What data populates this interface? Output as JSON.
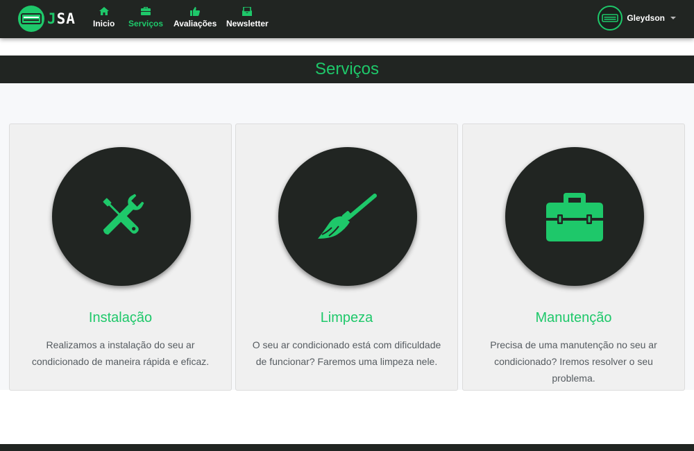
{
  "brand": {
    "letter_j": "J",
    "letters_sa": "SA",
    "logo_icon": "air-conditioner-icon"
  },
  "nav": [
    {
      "label": "Inicio",
      "icon": "home-icon",
      "active": false
    },
    {
      "label": "Serviços",
      "icon": "toolbox-icon",
      "active": true
    },
    {
      "label": "Avaliações",
      "icon": "thumbs-up-icon",
      "active": false
    },
    {
      "label": "Newsletter",
      "icon": "newsletter-icon",
      "active": false
    }
  ],
  "user": {
    "name": "Gleydson",
    "avatar_icon": "air-conditioner-icon"
  },
  "section": {
    "title": "Serviços"
  },
  "cards": [
    {
      "title": "Instalação",
      "description": "Realizamos a instalação do seu ar condicionado de maneira rápida e eficaz.",
      "icon": "tools-icon"
    },
    {
      "title": "Limpeza",
      "description": "O seu ar condicionado está com dificuldade de funcionar? Faremos uma limpeza nele.",
      "icon": "broom-icon"
    },
    {
      "title": "Manutenção",
      "description": "Precisa de uma manutenção no seu ar condicionado? Iremos resolver o seu problema.",
      "icon": "toolbox-icon"
    }
  ],
  "colors": {
    "accent": "#1ec86a",
    "dark": "#212522",
    "text_muted": "#555b60",
    "card_bg": "#f0f0f0"
  }
}
